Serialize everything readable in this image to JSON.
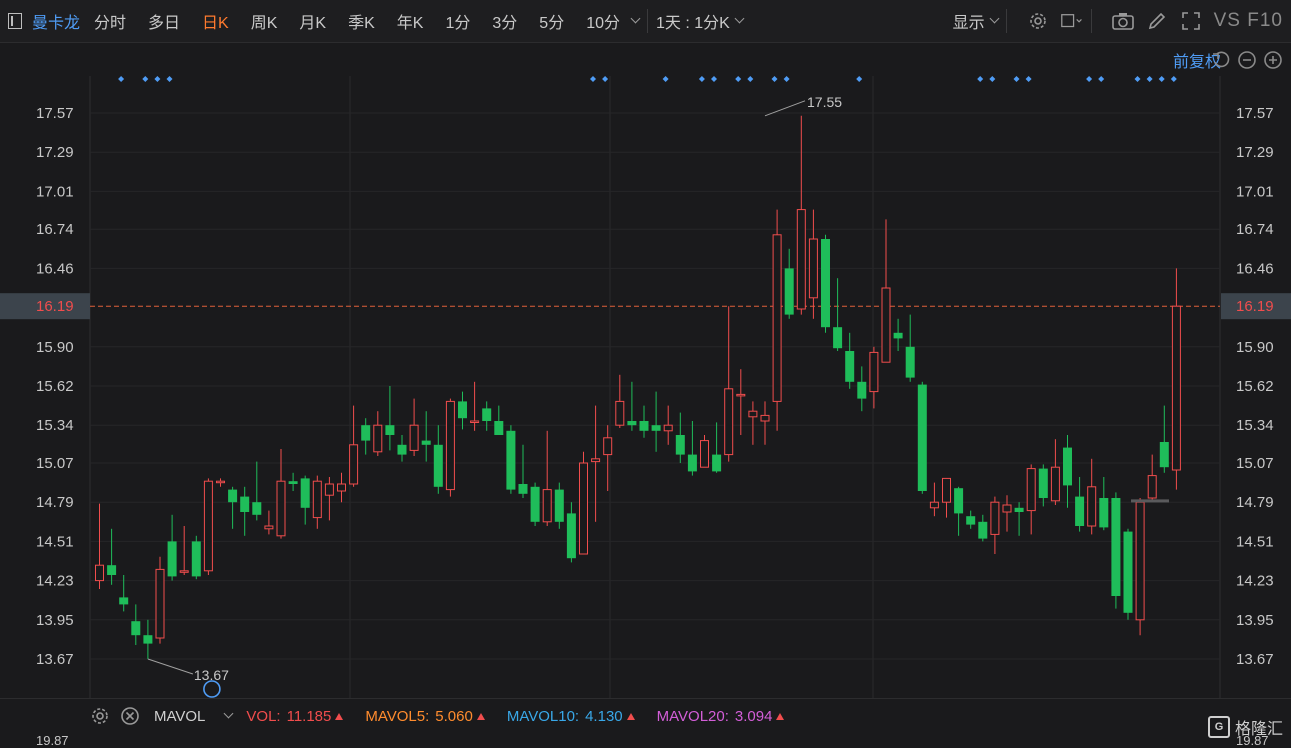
{
  "toolbar": {
    "stock_name": "曼卡龙",
    "tabs": [
      "分时",
      "多日",
      "日K",
      "周K",
      "月K",
      "季K",
      "年K",
      "1分",
      "3分",
      "5分",
      "10分"
    ],
    "active_tab": "日K",
    "period_select": "1天 : 1分K",
    "display_label": "显示",
    "vs_label": "VS F10"
  },
  "adjust_label": "前复权",
  "colors": {
    "up": "#f14d4d",
    "down": "#1fbd5a",
    "accent": "#ff7a2e",
    "blue": "#4f9cf5"
  },
  "chart_data": {
    "type": "candlestick",
    "ylim": [
      13.5,
      17.7
    ],
    "y_ticks": [
      "17.57",
      "17.29",
      "17.01",
      "16.74",
      "16.46",
      "16.19",
      "15.90",
      "15.62",
      "15.34",
      "15.07",
      "14.79",
      "14.51",
      "14.23",
      "13.95",
      "13.67"
    ],
    "y_tick_values": [
      17.57,
      17.29,
      17.01,
      16.74,
      16.46,
      16.19,
      15.9,
      15.62,
      15.34,
      15.07,
      14.79,
      14.51,
      14.23,
      13.95,
      13.67
    ],
    "current_price": "16.19",
    "current_value": 16.19,
    "max_label": "17.55",
    "min_label": "13.67",
    "max_value": 17.55,
    "min_value": 13.67,
    "max_index": 55,
    "min_index": 4,
    "candles": [
      [
        14.23,
        14.34,
        14.78,
        14.17
      ],
      [
        14.34,
        14.27,
        14.6,
        14.2
      ],
      [
        14.11,
        14.06,
        14.27,
        14.01
      ],
      [
        13.94,
        13.84,
        14.06,
        13.77
      ],
      [
        13.84,
        13.78,
        13.95,
        13.67
      ],
      [
        13.82,
        14.31,
        14.4,
        13.78
      ],
      [
        14.51,
        14.26,
        14.7,
        14.23
      ],
      [
        14.3,
        14.3,
        14.62,
        14.27
      ],
      [
        14.51,
        14.26,
        14.55,
        14.24
      ],
      [
        14.3,
        14.94,
        14.96,
        14.27
      ],
      [
        14.94,
        14.94,
        14.96,
        14.9
      ],
      [
        14.88,
        14.79,
        14.9,
        14.6
      ],
      [
        14.83,
        14.72,
        14.9,
        14.55
      ],
      [
        14.79,
        14.7,
        15.08,
        14.66
      ],
      [
        14.6,
        14.62,
        14.73,
        14.56
      ],
      [
        14.55,
        14.94,
        15.17,
        14.53
      ],
      [
        14.94,
        14.92,
        15.0,
        14.87
      ],
      [
        14.96,
        14.75,
        14.98,
        14.63
      ],
      [
        14.68,
        14.94,
        14.98,
        14.6
      ],
      [
        14.84,
        14.92,
        14.97,
        14.66
      ],
      [
        14.87,
        14.92,
        15.0,
        14.79
      ],
      [
        14.92,
        15.2,
        15.48,
        14.9
      ],
      [
        15.34,
        15.23,
        15.39,
        15.13
      ],
      [
        15.15,
        15.34,
        15.44,
        15.12
      ],
      [
        15.34,
        15.27,
        15.62,
        15.16
      ],
      [
        15.2,
        15.13,
        15.27,
        15.08
      ],
      [
        15.16,
        15.34,
        15.53,
        15.12
      ],
      [
        15.23,
        15.2,
        15.44,
        15.08
      ],
      [
        15.2,
        14.9,
        15.34,
        14.85
      ],
      [
        14.88,
        15.51,
        15.53,
        14.83
      ],
      [
        15.51,
        15.39,
        15.58,
        15.31
      ],
      [
        15.37,
        15.37,
        15.65,
        15.3
      ],
      [
        15.46,
        15.37,
        15.51,
        15.3
      ],
      [
        15.37,
        15.27,
        15.48,
        15.27
      ],
      [
        15.3,
        14.88,
        15.34,
        14.85
      ],
      [
        14.92,
        14.85,
        15.2,
        14.82
      ],
      [
        14.9,
        14.65,
        14.93,
        14.62
      ],
      [
        14.65,
        14.88,
        15.3,
        14.62
      ],
      [
        14.88,
        14.65,
        14.93,
        14.6
      ],
      [
        14.71,
        14.39,
        14.79,
        14.36
      ],
      [
        14.42,
        15.07,
        15.15,
        14.42
      ],
      [
        15.08,
        15.1,
        15.48,
        14.65
      ],
      [
        15.13,
        15.25,
        15.34,
        14.87
      ],
      [
        15.34,
        15.51,
        15.7,
        15.32
      ],
      [
        15.37,
        15.34,
        15.65,
        15.3
      ],
      [
        15.37,
        15.3,
        15.48,
        15.25
      ],
      [
        15.34,
        15.3,
        15.58,
        15.15
      ],
      [
        15.3,
        15.34,
        15.48,
        15.2
      ],
      [
        15.27,
        15.13,
        15.43,
        15.07
      ],
      [
        15.13,
        15.01,
        15.37,
        14.98
      ],
      [
        15.04,
        15.23,
        15.27,
        15.04
      ],
      [
        15.13,
        15.01,
        15.36,
        15.0
      ],
      [
        15.13,
        15.6,
        16.19,
        15.08
      ],
      [
        15.56,
        15.56,
        15.74,
        15.27
      ],
      [
        15.4,
        15.44,
        15.51,
        15.2
      ],
      [
        15.37,
        15.41,
        15.51,
        15.2
      ],
      [
        15.51,
        16.7,
        16.88,
        15.3
      ],
      [
        16.46,
        16.13,
        16.6,
        16.1
      ],
      [
        16.17,
        16.88,
        17.55,
        16.13
      ],
      [
        16.25,
        16.67,
        16.88,
        16.1
      ],
      [
        16.67,
        16.04,
        16.7,
        16.0
      ],
      [
        16.04,
        15.89,
        16.39,
        15.87
      ],
      [
        15.87,
        15.65,
        16.0,
        15.6
      ],
      [
        15.65,
        15.53,
        15.76,
        15.44
      ],
      [
        15.58,
        15.86,
        15.9,
        15.46
      ],
      [
        15.79,
        16.32,
        16.81,
        15.79
      ],
      [
        16.0,
        15.96,
        16.1,
        15.87
      ],
      [
        15.9,
        15.68,
        16.13,
        15.65
      ],
      [
        15.63,
        14.87,
        15.65,
        14.85
      ],
      [
        14.75,
        14.79,
        14.93,
        14.69
      ],
      [
        14.79,
        14.96,
        14.96,
        14.68
      ],
      [
        14.89,
        14.71,
        14.9,
        14.55
      ],
      [
        14.69,
        14.63,
        14.73,
        14.6
      ],
      [
        14.65,
        14.53,
        14.7,
        14.51
      ],
      [
        14.56,
        14.79,
        14.83,
        14.42
      ],
      [
        14.72,
        14.77,
        14.84,
        14.58
      ],
      [
        14.75,
        14.72,
        14.79,
        14.55
      ],
      [
        14.73,
        15.03,
        15.06,
        14.56
      ],
      [
        15.03,
        14.82,
        15.06,
        14.76
      ],
      [
        14.8,
        15.04,
        15.24,
        14.77
      ],
      [
        15.18,
        14.91,
        15.27,
        14.75
      ],
      [
        14.83,
        14.62,
        14.97,
        14.58
      ],
      [
        14.62,
        14.9,
        15.1,
        14.56
      ],
      [
        14.82,
        14.61,
        14.97,
        14.59
      ],
      [
        14.82,
        14.12,
        14.86,
        14.03
      ],
      [
        14.58,
        14.0,
        14.6,
        13.95
      ],
      [
        13.95,
        14.79,
        14.82,
        13.84
      ],
      [
        14.82,
        14.98,
        15.13,
        14.8
      ],
      [
        15.22,
        15.04,
        15.48,
        15.0
      ],
      [
        15.02,
        16.19,
        16.46,
        14.88
      ]
    ]
  },
  "bottom": {
    "indicator": "MAVOL",
    "vol_label": "VOL:",
    "vol_value": "11.185",
    "vol_color": "#f14d4d",
    "mavol5_label": "MAVOL5:",
    "mavol5_value": "5.060",
    "mavol5_color": "#ff8c2e",
    "mavol10_label": "MAVOL10:",
    "mavol10_value": "4.130",
    "mavol10_color": "#39a8e8",
    "mavol20_label": "MAVOL20:",
    "mavol20_value": "3.094",
    "mavol20_color": "#d35ed8",
    "left_cut": "19.87",
    "right_cut": "19.87"
  },
  "watermark": "格隆汇"
}
